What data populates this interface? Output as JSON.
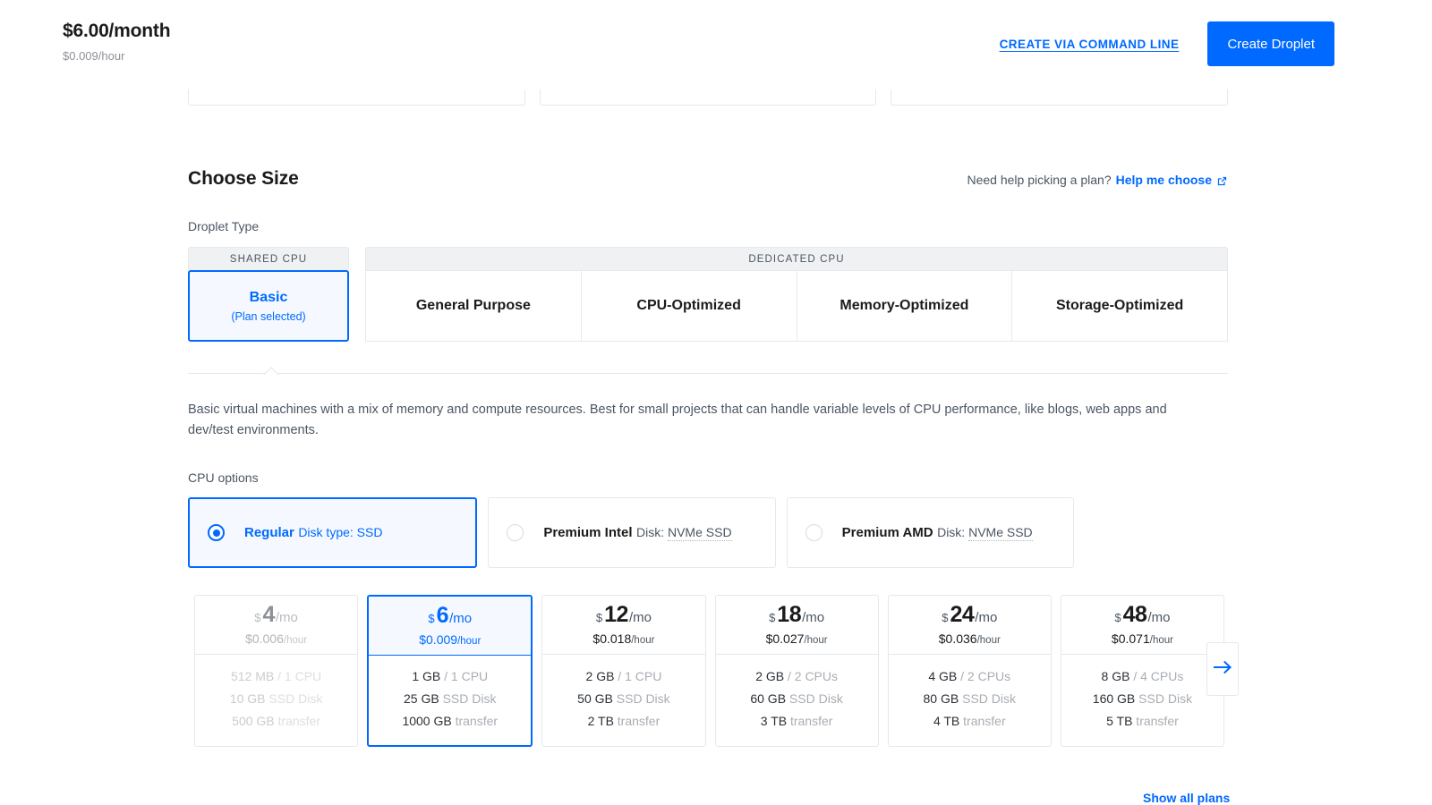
{
  "header": {
    "price_month": "$6.00/month",
    "price_hour": "$0.009/hour",
    "command_line_link": "CREATE VIA COMMAND LINE",
    "create_button": "Create Droplet"
  },
  "choose_size": {
    "title": "Choose Size",
    "help_prefix": "Need help picking a plan?",
    "help_link": "Help me choose",
    "help_icon": "external-link-icon"
  },
  "droplet_type": {
    "label": "Droplet Type",
    "groups": [
      {
        "header": "SHARED CPU",
        "tabs": [
          {
            "title": "Basic",
            "sub": "(Plan selected)",
            "selected": true
          }
        ]
      },
      {
        "header": "DEDICATED CPU",
        "tabs": [
          {
            "title": "General Purpose",
            "sub": "",
            "selected": false
          },
          {
            "title": "CPU-Optimized",
            "sub": "",
            "selected": false
          },
          {
            "title": "Memory-Optimized",
            "sub": "",
            "selected": false
          },
          {
            "title": "Storage-Optimized",
            "sub": "",
            "selected": false
          }
        ]
      }
    ],
    "description": "Basic virtual machines with a mix of memory and compute resources. Best for small projects that can handle variable levels of CPU performance, like blogs, web apps and dev/test environments."
  },
  "cpu_options": {
    "label": "CPU options",
    "items": [
      {
        "name": "Regular",
        "disk_prefix": "Disk type: ",
        "disk_value": "SSD",
        "selected": true,
        "dotted": false
      },
      {
        "name": "Premium Intel",
        "disk_prefix": "Disk: ",
        "disk_value": "NVMe SSD",
        "selected": false,
        "dotted": true
      },
      {
        "name": "Premium AMD",
        "disk_prefix": "Disk: ",
        "disk_value": "NVMe SSD",
        "selected": false,
        "dotted": true
      }
    ]
  },
  "plans": [
    {
      "dollar": "$",
      "amount": "4",
      "per": "/mo",
      "hourly": "$0.006",
      "hourly_unit": "/hour",
      "memory": "512 MB",
      "cpu": " / 1 CPU",
      "disk": "10 GB",
      "disk_unit": " SSD Disk",
      "transfer": "500 GB",
      "transfer_unit": " transfer",
      "selected": false,
      "disabled": true
    },
    {
      "dollar": "$",
      "amount": "6",
      "per": "/mo",
      "hourly": "$0.009",
      "hourly_unit": "/hour",
      "memory": "1 GB",
      "cpu": " / 1 CPU",
      "disk": "25 GB",
      "disk_unit": " SSD Disk",
      "transfer": "1000 GB",
      "transfer_unit": " transfer",
      "selected": true,
      "disabled": false
    },
    {
      "dollar": "$",
      "amount": "12",
      "per": "/mo",
      "hourly": "$0.018",
      "hourly_unit": "/hour",
      "memory": "2 GB",
      "cpu": " / 1 CPU",
      "disk": "50 GB",
      "disk_unit": " SSD Disk",
      "transfer": "2 TB",
      "transfer_unit": " transfer",
      "selected": false,
      "disabled": false
    },
    {
      "dollar": "$",
      "amount": "18",
      "per": "/mo",
      "hourly": "$0.027",
      "hourly_unit": "/hour",
      "memory": "2 GB",
      "cpu": " / 2 CPUs",
      "disk": "60 GB",
      "disk_unit": " SSD Disk",
      "transfer": "3 TB",
      "transfer_unit": " transfer",
      "selected": false,
      "disabled": false
    },
    {
      "dollar": "$",
      "amount": "24",
      "per": "/mo",
      "hourly": "$0.036",
      "hourly_unit": "/hour",
      "memory": "4 GB",
      "cpu": " / 2 CPUs",
      "disk": "80 GB",
      "disk_unit": " SSD Disk",
      "transfer": "4 TB",
      "transfer_unit": " transfer",
      "selected": false,
      "disabled": false
    },
    {
      "dollar": "$",
      "amount": "48",
      "per": "/mo",
      "hourly": "$0.071",
      "hourly_unit": "/hour",
      "memory": "8 GB",
      "cpu": " / 4 CPUs",
      "disk": "160 GB",
      "disk_unit": " SSD Disk",
      "transfer": "5 TB",
      "transfer_unit": " transfer",
      "selected": false,
      "disabled": false
    }
  ],
  "pager": {
    "next_icon": "arrow-right-icon"
  },
  "bottom": {
    "link": "Show all plans"
  },
  "colors": {
    "accent": "#0069ff",
    "accent_bg": "#f5f9ff",
    "border": "#e5e8ec",
    "text": "#1b1b1b",
    "muted": "#4b5663",
    "disabled": "#c9ccd0"
  }
}
